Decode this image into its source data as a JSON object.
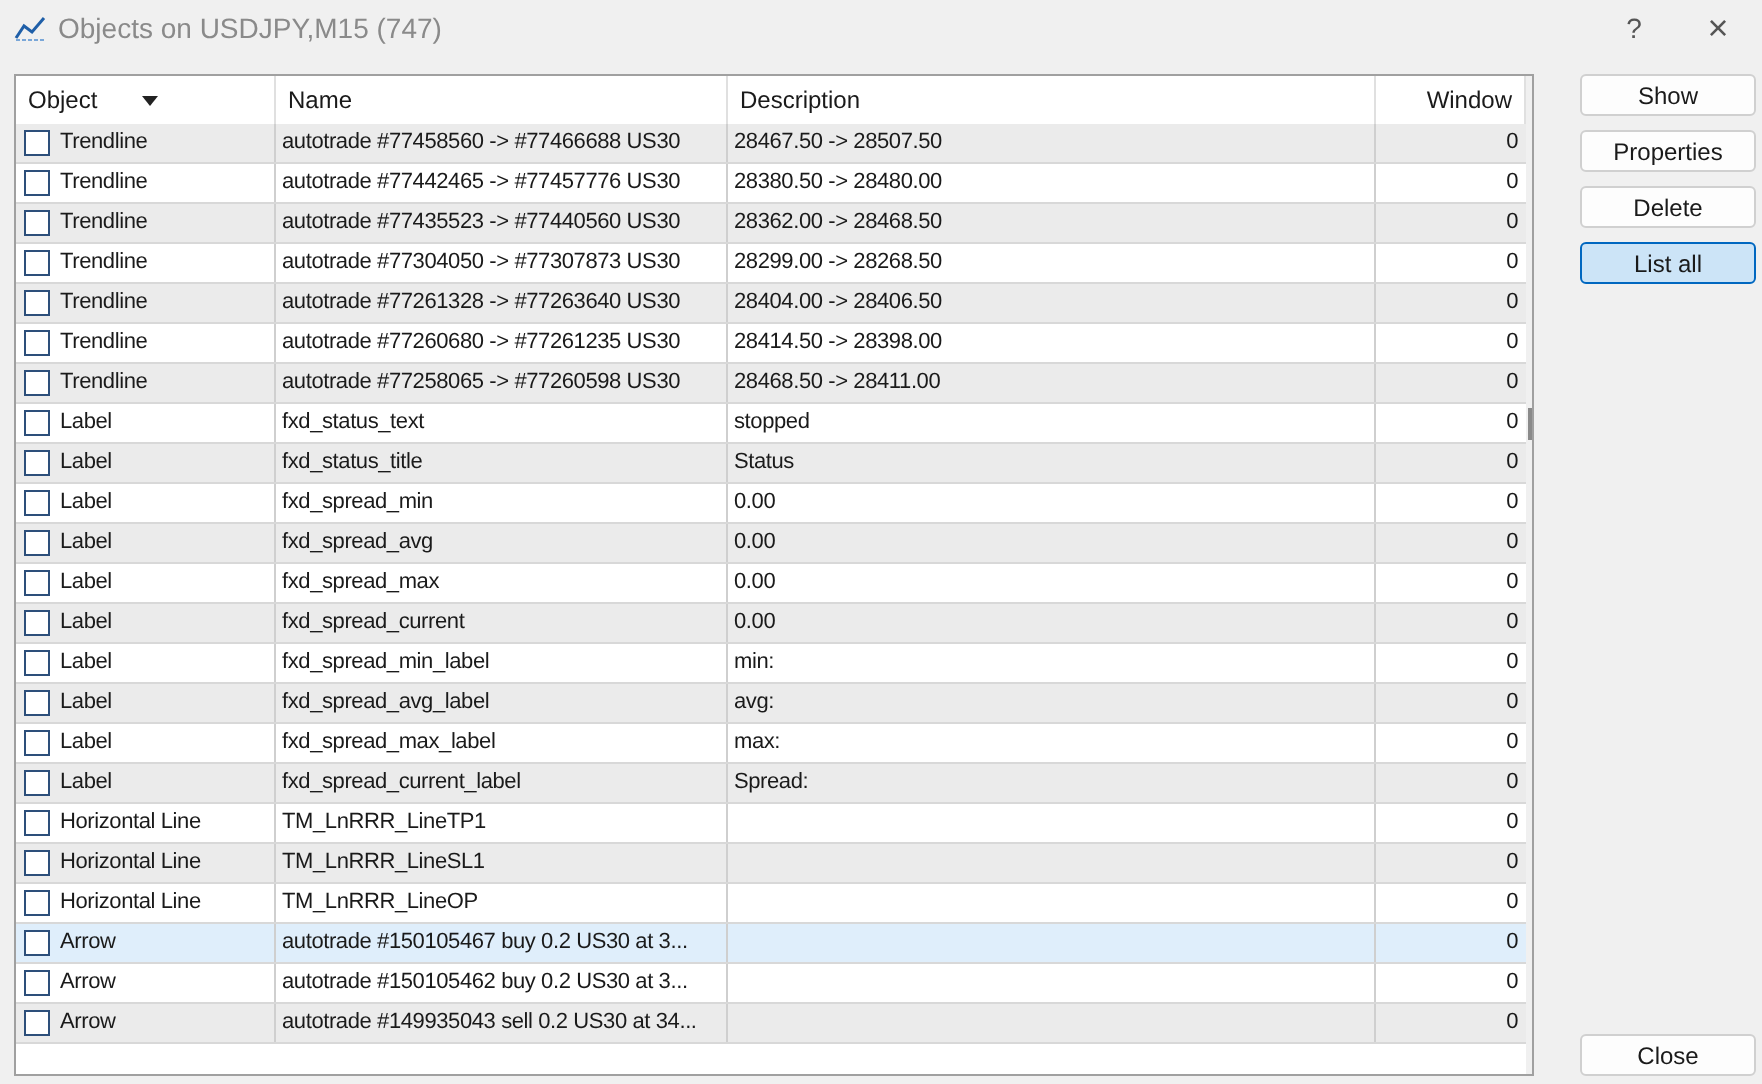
{
  "window": {
    "title": "Objects on USDJPY,M15 (747)",
    "help": "?",
    "close": "×"
  },
  "table": {
    "columns": [
      {
        "label": "Object",
        "sorted": true
      },
      {
        "label": "Name",
        "sorted": false
      },
      {
        "label": "Description",
        "sorted": false
      },
      {
        "label": "Window",
        "sorted": false
      }
    ],
    "rows": [
      {
        "object": "Trendline",
        "name": "autotrade #77458560 -> #77466688 US30",
        "description": "28467.50 -> 28507.50",
        "window": "0",
        "checked": false,
        "selected": false
      },
      {
        "object": "Trendline",
        "name": "autotrade #77442465 -> #77457776 US30",
        "description": "28380.50 -> 28480.00",
        "window": "0",
        "checked": false,
        "selected": false
      },
      {
        "object": "Trendline",
        "name": "autotrade #77435523 -> #77440560 US30",
        "description": "28362.00 -> 28468.50",
        "window": "0",
        "checked": false,
        "selected": false
      },
      {
        "object": "Trendline",
        "name": "autotrade #77304050 -> #77307873 US30",
        "description": "28299.00 -> 28268.50",
        "window": "0",
        "checked": false,
        "selected": false
      },
      {
        "object": "Trendline",
        "name": "autotrade #77261328 -> #77263640 US30",
        "description": "28404.00 -> 28406.50",
        "window": "0",
        "checked": false,
        "selected": false
      },
      {
        "object": "Trendline",
        "name": "autotrade #77260680 -> #77261235 US30",
        "description": "28414.50 -> 28398.00",
        "window": "0",
        "checked": false,
        "selected": false
      },
      {
        "object": "Trendline",
        "name": "autotrade #77258065 -> #77260598 US30",
        "description": "28468.50 -> 28411.00",
        "window": "0",
        "checked": false,
        "selected": false
      },
      {
        "object": "Label",
        "name": "fxd_status_text",
        "description": "stopped",
        "window": "0",
        "checked": false,
        "selected": false
      },
      {
        "object": "Label",
        "name": "fxd_status_title",
        "description": "Status",
        "window": "0",
        "checked": false,
        "selected": false
      },
      {
        "object": "Label",
        "name": "fxd_spread_min",
        "description": "0.00",
        "window": "0",
        "checked": false,
        "selected": false
      },
      {
        "object": "Label",
        "name": "fxd_spread_avg",
        "description": "0.00",
        "window": "0",
        "checked": false,
        "selected": false
      },
      {
        "object": "Label",
        "name": "fxd_spread_max",
        "description": "0.00",
        "window": "0",
        "checked": false,
        "selected": false
      },
      {
        "object": "Label",
        "name": "fxd_spread_current",
        "description": "0.00",
        "window": "0",
        "checked": false,
        "selected": false
      },
      {
        "object": "Label",
        "name": "fxd_spread_min_label",
        "description": "min:",
        "window": "0",
        "checked": false,
        "selected": false
      },
      {
        "object": "Label",
        "name": "fxd_spread_avg_label",
        "description": "avg:",
        "window": "0",
        "checked": false,
        "selected": false
      },
      {
        "object": "Label",
        "name": "fxd_spread_max_label",
        "description": "max:",
        "window": "0",
        "checked": false,
        "selected": false
      },
      {
        "object": "Label",
        "name": "fxd_spread_current_label",
        "description": "Spread:",
        "window": "0",
        "checked": false,
        "selected": false
      },
      {
        "object": "Horizontal Line",
        "name": "TM_LnRRR_LineTP1",
        "window": "0",
        "checked": false,
        "selected": false
      },
      {
        "object": "Horizontal Line",
        "name": "TM_LnRRR_LineSL1",
        "window": "0",
        "checked": false,
        "selected": false
      },
      {
        "object": "Horizontal Line",
        "name": "TM_LnRRR_LineOP",
        "window": "0",
        "checked": false,
        "selected": false
      },
      {
        "object": "Arrow",
        "name": "autotrade #150105467 buy 0.2 US30 at 3...",
        "window": "0",
        "checked": false,
        "selected": true
      },
      {
        "object": "Arrow",
        "name": "autotrade #150105462 buy 0.2 US30 at 3...",
        "window": "0",
        "checked": false,
        "selected": false
      },
      {
        "object": "Arrow",
        "name": "autotrade #149935043 sell 0.2 US30 at 34...",
        "window": "0",
        "checked": false,
        "selected": false
      }
    ]
  },
  "buttons": [
    {
      "label": "Show",
      "focused": false
    },
    {
      "label": "Properties",
      "focused": false
    },
    {
      "label": "Delete",
      "focused": false
    },
    {
      "label": "List all",
      "focused": true
    }
  ],
  "close_button": "Close"
}
